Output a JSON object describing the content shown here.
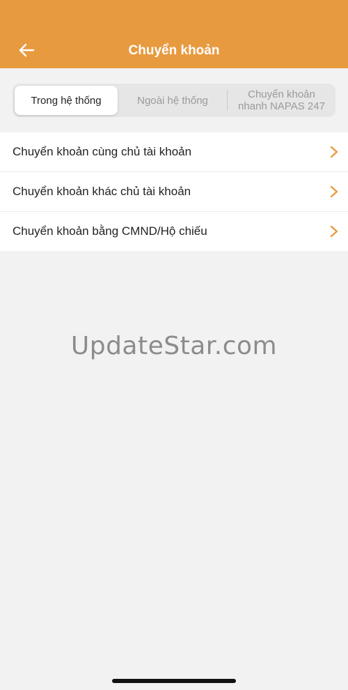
{
  "header": {
    "title": "Chuyển khoản",
    "back_icon": "arrow-left-icon",
    "background": "#e89a3f"
  },
  "tabs": [
    {
      "label": "Trong hệ thống",
      "selected": true
    },
    {
      "label": "Ngoài hệ thống",
      "selected": false
    },
    {
      "label": "Chuyển khoản nhanh NAPAS 247",
      "selected": false
    }
  ],
  "menu": {
    "items": [
      {
        "label": "Chuyển khoản cùng chủ tài khoản",
        "icon": "chevron-right-icon"
      },
      {
        "label": "Chuyển khoản khác chủ tài khoản",
        "icon": "chevron-right-icon"
      },
      {
        "label": "Chuyển khoản bằng CMND/Hộ chiếu",
        "icon": "chevron-right-icon"
      }
    ],
    "chevron_color": "#e89a3f"
  },
  "watermark": {
    "text": "UpdateStar.com"
  }
}
